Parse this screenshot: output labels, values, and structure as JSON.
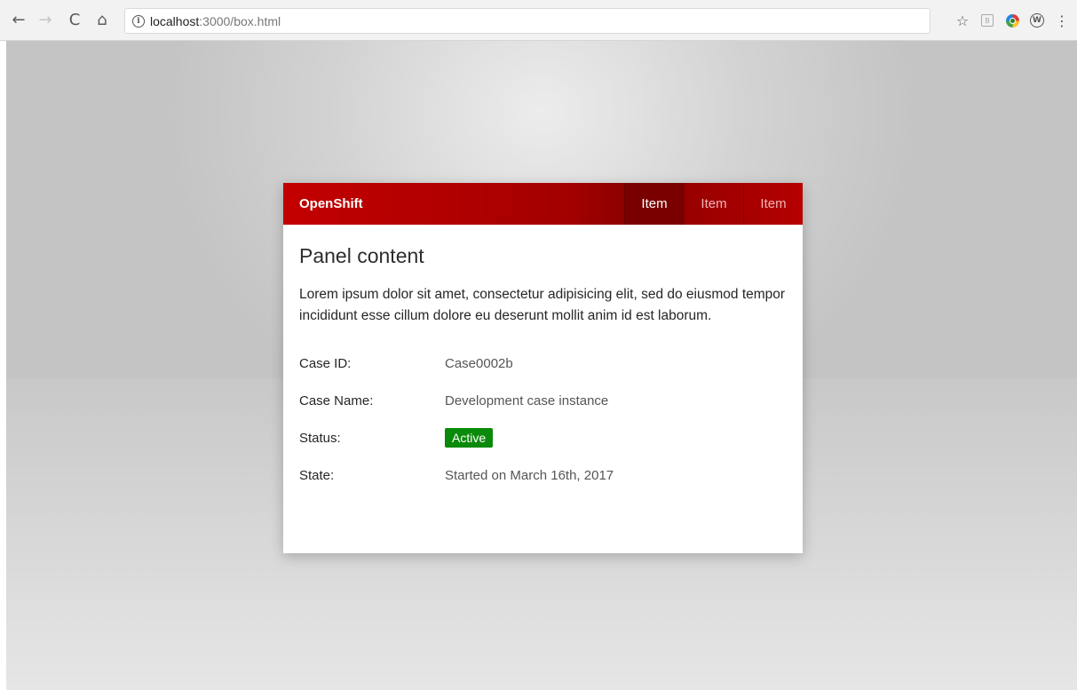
{
  "browser": {
    "url_host": "localhost",
    "url_path": ":3000/box.html",
    "info_symbol": "i"
  },
  "icons": {
    "back": "←",
    "forward": "→",
    "reload": "C",
    "home": "⌂",
    "star": "☆",
    "menu": "⋮",
    "ext_b": "B",
    "ext_w": "W"
  },
  "panel": {
    "brand": "OpenShift",
    "nav": [
      {
        "label": "Item",
        "active": true
      },
      {
        "label": "Item",
        "active": false
      },
      {
        "label": "Item",
        "active": false
      }
    ],
    "title": "Panel content",
    "description": "Lorem ipsum dolor sit amet, consectetur adipisicing elit, sed do eiusmod tempor incididunt esse cillum dolore eu deserunt mollit anim id est laborum.",
    "fields": [
      {
        "label": "Case ID:",
        "value": "Case0002b"
      },
      {
        "label": "Case Name:",
        "value": "Development case instance"
      },
      {
        "label": "Status:",
        "value": "Active"
      },
      {
        "label": "State:",
        "value": "Started on March 16th, 2017"
      }
    ]
  },
  "colors": {
    "header_red": "#c30000",
    "active_nav": "#7a0000",
    "status_green": "#0a8a0a"
  }
}
